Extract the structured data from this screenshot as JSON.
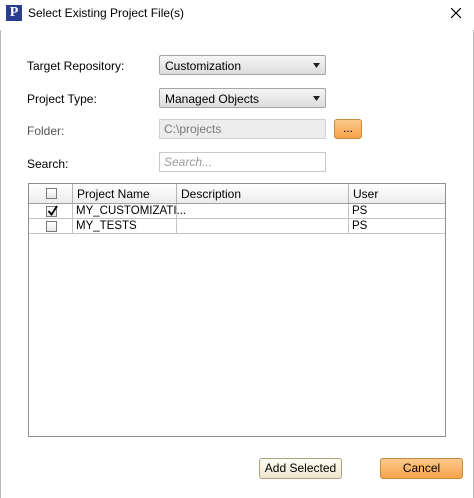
{
  "window": {
    "title": "Select Existing Project File(s)",
    "app_icon_letter": "P"
  },
  "form": {
    "target_repository_label": "Target Repository:",
    "target_repository_value": "Customization",
    "project_type_label": "Project Type:",
    "project_type_value": "Managed Objects",
    "folder_label": "Folder:",
    "folder_value": "C:\\projects",
    "browse_label": "...",
    "search_label": "Search:",
    "search_placeholder": "Search..."
  },
  "table": {
    "columns": [
      "Project Name",
      "Description",
      "User"
    ],
    "rows": [
      {
        "checked": true,
        "project_name": "MY_CUSTOMIZATI...",
        "description": "",
        "user": "PS"
      },
      {
        "checked": false,
        "project_name": "MY_TESTS",
        "description": "",
        "user": "PS"
      }
    ]
  },
  "buttons": {
    "add_selected": "Add Selected",
    "cancel": "Cancel"
  },
  "colors": {
    "accent_orange": "#f5a34a",
    "app_icon_blue": "#2b3d91"
  }
}
